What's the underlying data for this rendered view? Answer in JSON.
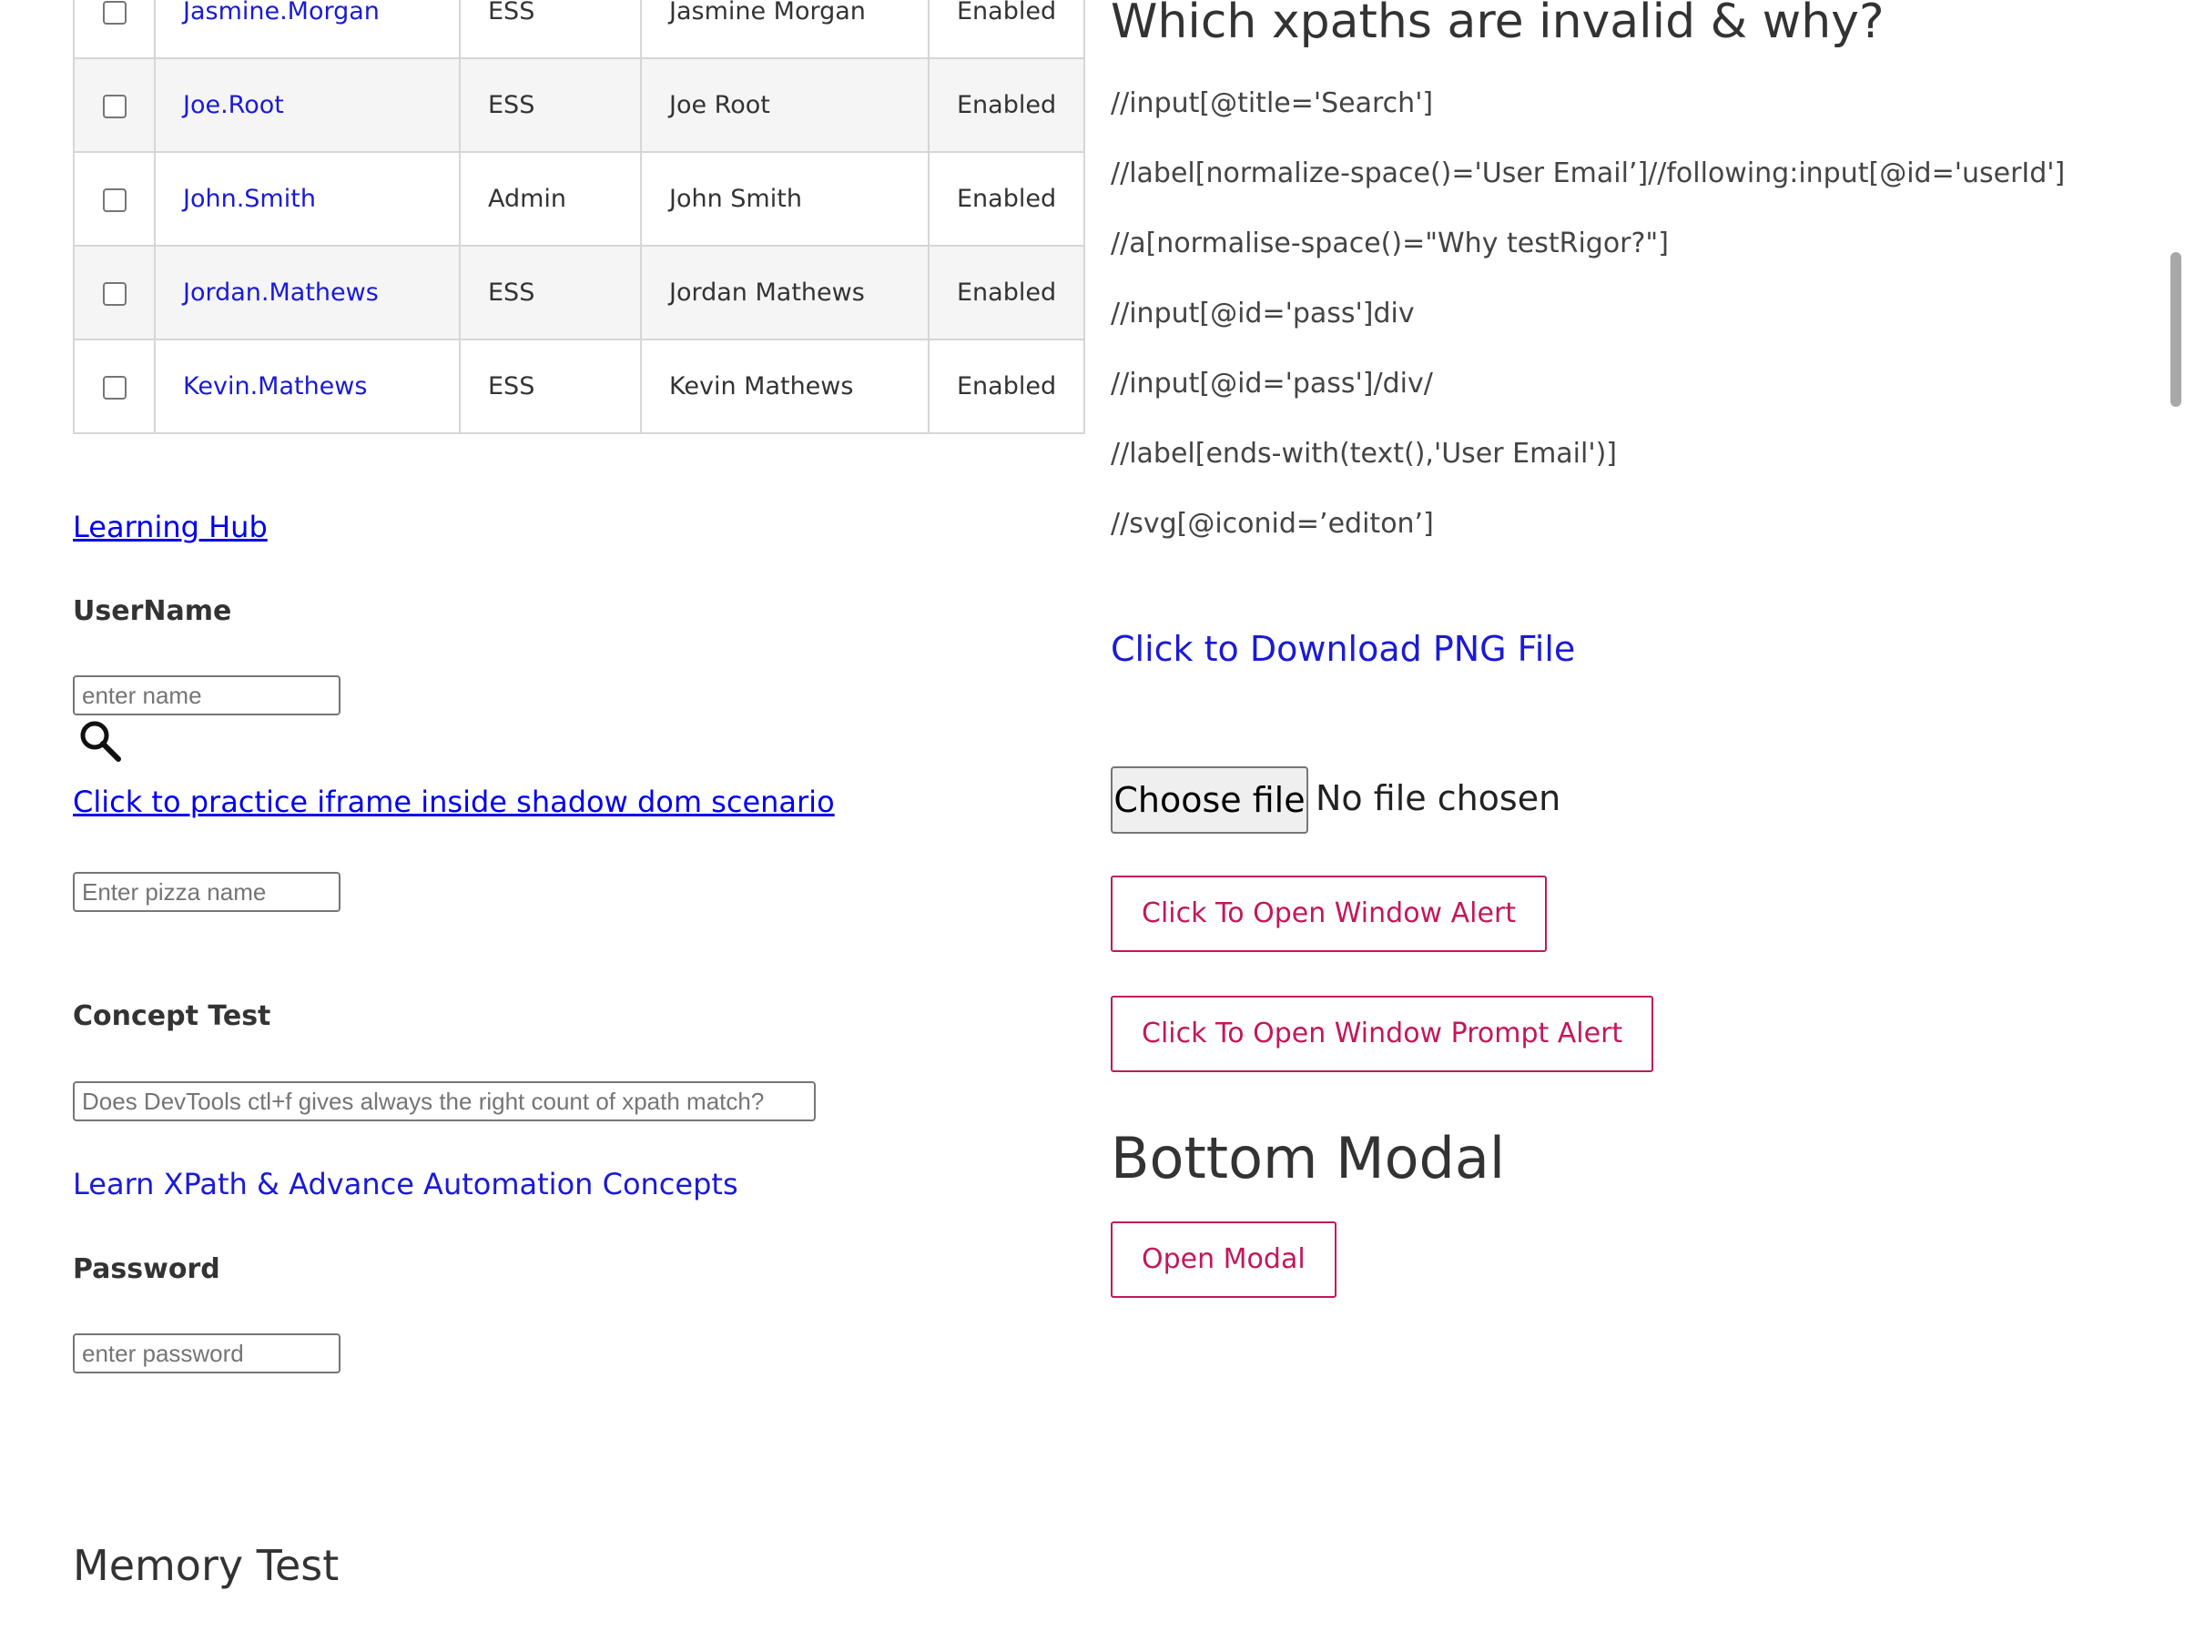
{
  "users_table": {
    "rows": [
      {
        "username": "Jasmine.Morgan",
        "role": "ESS",
        "employee_name": "Jasmine Morgan",
        "status": "Enabled"
      },
      {
        "username": "Joe.Root",
        "role": "ESS",
        "employee_name": "Joe Root",
        "status": "Enabled"
      },
      {
        "username": "John.Smith",
        "role": "Admin",
        "employee_name": "John Smith",
        "status": "Enabled"
      },
      {
        "username": "Jordan.Mathews",
        "role": "ESS",
        "employee_name": "Jordan Mathews",
        "status": "Enabled"
      },
      {
        "username": "Kevin.Mathews",
        "role": "ESS",
        "employee_name": "Kevin Mathews",
        "status": "Enabled"
      }
    ]
  },
  "left": {
    "learning_hub_link": "Learning Hub",
    "username_label": "UserName",
    "username_placeholder": "enter name",
    "search_icon": "search-icon",
    "iframe_shadow_link": "Click to practice iframe inside shadow dom scenario",
    "pizza_placeholder": "Enter pizza name",
    "concept_test_label": "Concept Test",
    "concept_test_placeholder": "Does DevTools ctl+f gives always the right count of xpath match?",
    "learn_xpath_link": "Learn XPath & Advance Automation Concepts",
    "password_label": "Password",
    "password_placeholder": "enter password",
    "memory_test_heading": "Memory Test"
  },
  "right": {
    "xpath_heading": "Which xpaths are invalid & why?",
    "xpaths": [
      "//input[@title='Search']",
      "//label[normalize-space()='User Email’]//following:input[@id='userId']",
      "//a[normalise-space()=\"Why testRigor?\"]",
      "//input[@id='pass']div",
      "//input[@id='pass']/div/",
      "//label[ends-with(text(),'User Email')]",
      "//svg[@iconid=’editon’]"
    ],
    "download_link": "Click to Download PNG File",
    "choose_file_label": "Choose file",
    "no_file_text": "No file chosen",
    "window_alert_button": "Click To Open Window Alert",
    "prompt_alert_button": "Click To Open Window Prompt Alert",
    "bottom_modal_heading": "Bottom Modal",
    "open_modal_button": "Open Modal"
  },
  "colors": {
    "link_blue": "#1a1ad6",
    "accent_pink": "#c2185b",
    "row_alt": "#f5f5f5"
  }
}
